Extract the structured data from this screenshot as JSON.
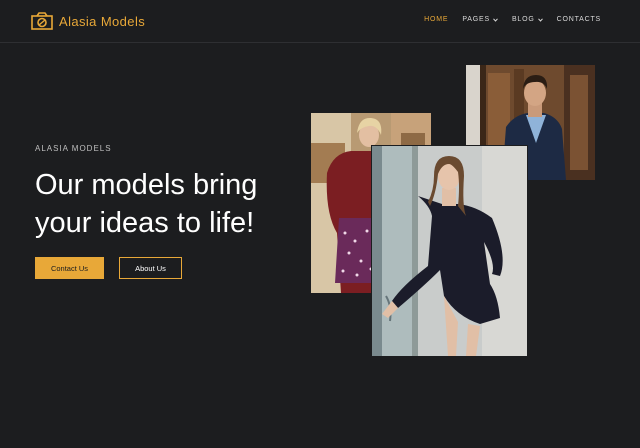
{
  "brand": {
    "name": "Alasia Models",
    "icon": "camera-logo-icon",
    "accent": "#e8a838"
  },
  "nav": {
    "items": [
      {
        "label": "HOME",
        "active": true
      },
      {
        "label": "PAGES",
        "dropdown": true
      },
      {
        "label": "BLOG",
        "dropdown": true
      },
      {
        "label": "CONTACTS"
      }
    ]
  },
  "hero": {
    "eyebrow": "ALASIA MODELS",
    "headline": "Our models bring your ideas to life!",
    "primary_button": "Contact Us",
    "secondary_button": "About Us"
  },
  "gallery": {
    "photos": [
      {
        "name": "model-man-suit-photo"
      },
      {
        "name": "model-woman-red-sweater-photo"
      },
      {
        "name": "model-woman-black-dress-photo"
      }
    ]
  },
  "colors": {
    "background": "#1c1d1f",
    "accent": "#e8a838",
    "text": "#ffffff"
  }
}
